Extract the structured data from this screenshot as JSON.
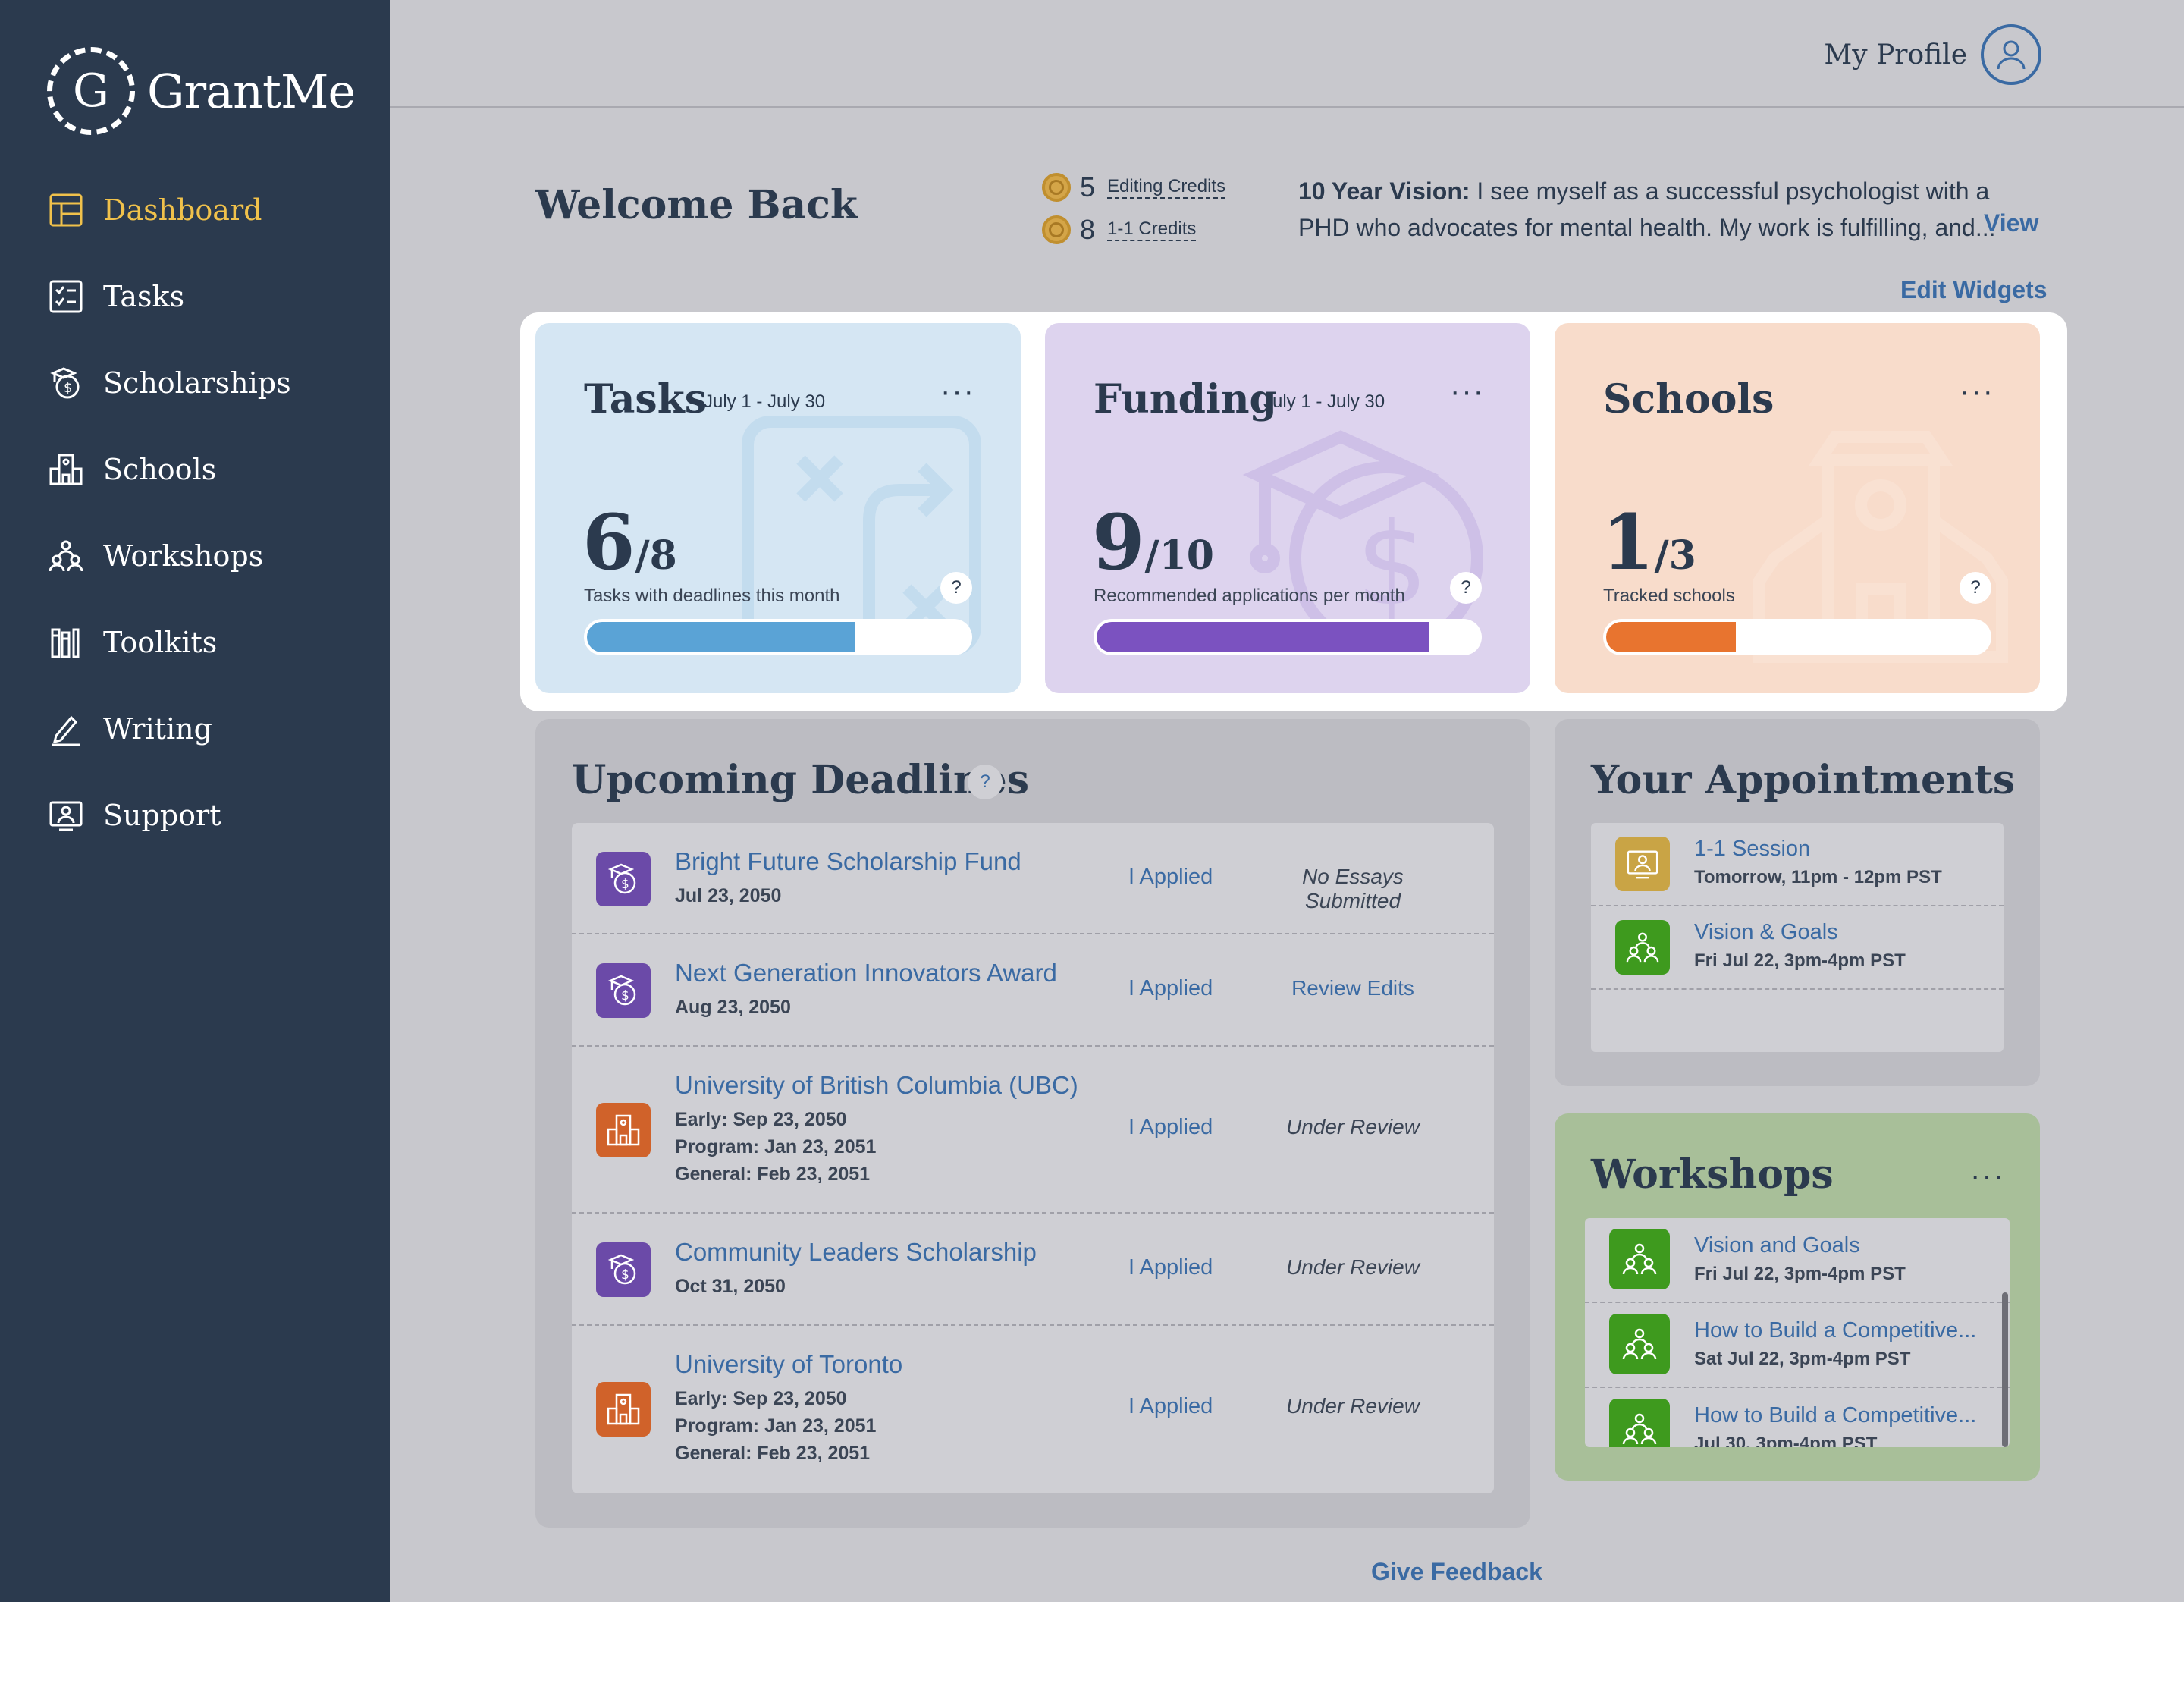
{
  "brand": {
    "logo_letter": "G",
    "name": "GrantMe"
  },
  "sidebar": {
    "items": [
      {
        "label": "Dashboard",
        "icon": "dashboard-icon",
        "active": true
      },
      {
        "label": "Tasks",
        "icon": "tasks-icon"
      },
      {
        "label": "Scholarships",
        "icon": "scholarship-icon"
      },
      {
        "label": "Schools",
        "icon": "school-icon"
      },
      {
        "label": "Workshops",
        "icon": "workshop-icon"
      },
      {
        "label": "Toolkits",
        "icon": "toolkit-icon"
      },
      {
        "label": "Writing",
        "icon": "pencil-icon"
      },
      {
        "label": "Support",
        "icon": "support-icon"
      }
    ]
  },
  "header": {
    "profile_label": "My Profile"
  },
  "welcome": "Welcome Back",
  "credits": [
    {
      "count": "5",
      "label": "Editing Credits"
    },
    {
      "count": "8",
      "label": "1-1 Credits"
    }
  ],
  "vision": {
    "label": "10 Year Vision:",
    "text": "I see myself as a successful psychologist with a PHD who advocates for mental health. My work is fulfilling, and...",
    "view": "View"
  },
  "edit_widgets": "Edit Widgets",
  "stats": {
    "tasks": {
      "title": "Tasks",
      "date": "July 1 - July 30",
      "value": "6",
      "total": "/8",
      "desc": "Tasks with deadlines this month",
      "progress": 0.7,
      "color": "#5aa3d6",
      "bg": "#d5e6f3"
    },
    "funding": {
      "title": "Funding",
      "date": "July 1 - July 30",
      "value": "9",
      "total": "/10",
      "desc": "Recommended applications per month",
      "progress": 0.87,
      "color": "#7b52c0",
      "bg": "#ddd3ee"
    },
    "schools": {
      "title": "Schools",
      "date": "",
      "value": "1",
      "total": "/3",
      "desc": "Tracked schools",
      "progress": 0.34,
      "color": "#e8742f",
      "bg": "#f8dccb"
    },
    "help": "?",
    "more": "···"
  },
  "deadlines": {
    "title": "Upcoming Deadlines",
    "help": "?",
    "rows": [
      {
        "name": "Bright Future Scholarship Fund",
        "type": "scholarship",
        "lines": [
          "Jul 23, 2050"
        ],
        "applied": "I Applied",
        "status": "No Essays Submitted",
        "status_link": false
      },
      {
        "name": "Next Generation Innovators Award",
        "type": "scholarship",
        "lines": [
          "Aug 23, 2050"
        ],
        "applied": "I Applied",
        "status": "Review Edits",
        "status_link": true
      },
      {
        "name": "University of British Columbia (UBC)",
        "type": "school",
        "lines": [
          "Early: Sep 23, 2050",
          "Program: Jan 23, 2051",
          "General: Feb 23, 2051"
        ],
        "applied": "I Applied",
        "status": "Under Review",
        "status_link": false
      },
      {
        "name": "Community Leaders Scholarship",
        "type": "scholarship",
        "lines": [
          "Oct 31, 2050"
        ],
        "applied": "I Applied",
        "status": "Under Review",
        "status_link": false
      },
      {
        "name": "University of Toronto",
        "type": "school",
        "lines": [
          "Early: Sep 23, 2050",
          "Program: Jan 23, 2051",
          "General: Feb 23, 2051"
        ],
        "applied": "I Applied",
        "status": "Under Review",
        "status_link": false
      }
    ]
  },
  "appointments": {
    "title": "Your Appointments",
    "items": [
      {
        "name": "1-1 Session",
        "time": "Tomorrow, 11pm - 12pm PST",
        "color": "#c9a445"
      },
      {
        "name": "Vision & Goals",
        "time": "Fri Jul 22, 3pm-4pm PST",
        "color": "#3e9a1e"
      }
    ]
  },
  "workshops": {
    "title": "Workshops",
    "more": "···",
    "items": [
      {
        "name": "Vision and Goals",
        "time": "Fri Jul 22, 3pm-4pm PST"
      },
      {
        "name": "How to Build a Competitive...",
        "time": "Sat Jul 22, 3pm-4pm PST"
      },
      {
        "name": "How to Build a Competitive...",
        "time": "Jul 30, 3pm-4pm PST"
      }
    ]
  },
  "feedback": "Give Feedback",
  "colors": {
    "sidebar": "#2b3a4e",
    "accent": "#f0c14b",
    "link": "#3a6aa3",
    "scholarship": "#6b4aa8",
    "school": "#d0622a",
    "workshop": "#3e9a1e"
  }
}
